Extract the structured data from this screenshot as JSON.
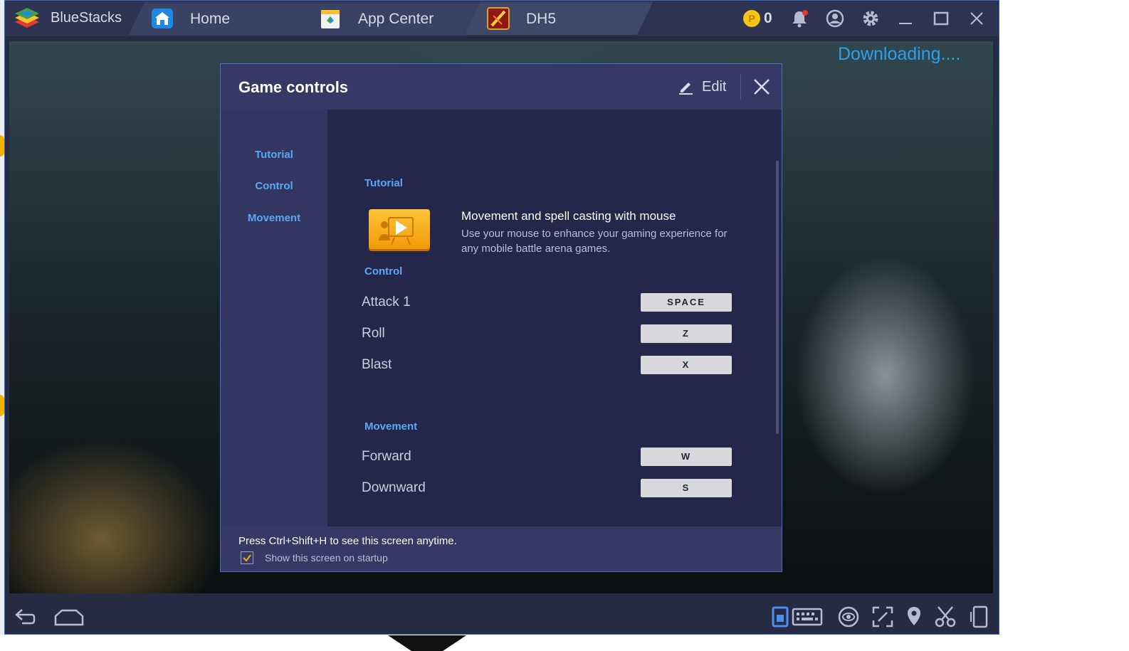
{
  "app": {
    "name": "BlueStacks"
  },
  "tabs": [
    {
      "label": "Home",
      "icon": "home-icon"
    },
    {
      "label": "App Center",
      "icon": "app-center-icon"
    },
    {
      "label": "DH5",
      "icon": "game-icon"
    }
  ],
  "titlebar": {
    "coin_count": "0"
  },
  "status": {
    "downloading": "Downloading...."
  },
  "dialog": {
    "title": "Game controls",
    "edit_label": "Edit",
    "sidebar": [
      "Tutorial",
      "Control",
      "Movement"
    ],
    "sections": {
      "tutorial": "Tutorial",
      "control": "Control",
      "movement": "Movement"
    },
    "tutorial": {
      "title": "Movement and spell casting with mouse",
      "description": "Use your mouse to enhance your gaming experience for any mobile battle arena games."
    },
    "controls": [
      {
        "name": "Attack 1",
        "key": "SPACE"
      },
      {
        "name": "Roll",
        "key": "Z"
      },
      {
        "name": "Blast",
        "key": "X"
      }
    ],
    "movement": [
      {
        "name": "Forward",
        "key": "W"
      },
      {
        "name": "Downward",
        "key": "S"
      }
    ],
    "footer": {
      "hint": "Press Ctrl+Shift+H to see this screen anytime.",
      "checkbox_label": "Show this screen on startup",
      "checkbox_checked": true
    }
  },
  "colors": {
    "accent": "#5aa8f5",
    "downloading": "#2ba0f0",
    "coin": "#f5c518",
    "tutorial_orange": "#f5a91e"
  }
}
